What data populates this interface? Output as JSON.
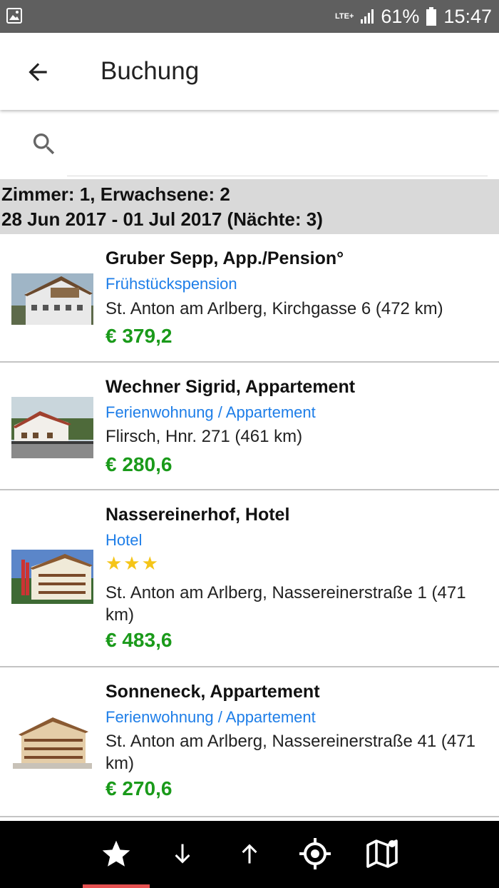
{
  "status_bar": {
    "network": "LTE+",
    "battery": "61%",
    "time": "15:47"
  },
  "app_bar": {
    "title": "Buchung"
  },
  "search": {
    "placeholder": ""
  },
  "summary": {
    "line1": "Zimmer: 1, Erwachsene: 2",
    "line2": "28 Jun 2017 - 01 Jul 2017 (Nächte: 3)"
  },
  "listings": [
    {
      "name": "Gruber Sepp, App./Pension°",
      "type": "Frühstückspension",
      "address": "St. Anton am Arlberg, Kirchgasse 6 (472 km)",
      "price": "€ 379,2",
      "stars": ""
    },
    {
      "name": "Wechner Sigrid, Appartement",
      "type": "Ferienwohnung / Appartement",
      "address": "Flirsch, Hnr. 271 (461 km)",
      "price": "€ 280,6",
      "stars": ""
    },
    {
      "name": "Nassereinerhof, Hotel",
      "type": "Hotel",
      "address": "St. Anton am Arlberg, Nassereinerstraße 1 (471 km)",
      "price": "€ 483,6",
      "stars": "★★★"
    },
    {
      "name": "Sonneneck, Appartement",
      "type": "Ferienwohnung / Appartement",
      "address": "St. Anton am Arlberg, Nassereinerstraße 41 (471 km)",
      "price": "€ 270,6",
      "stars": ""
    }
  ],
  "bottom_nav": {
    "items": [
      "favorites-star-icon",
      "sort-descending-icon",
      "sort-ascending-icon",
      "locate-crosshair-icon",
      "map-icon"
    ],
    "active_index": 0
  },
  "colors": {
    "accent_price": "#1a9a1a",
    "type_link": "#1e7ee8",
    "star": "#f5c518",
    "indicator": "#e55050"
  }
}
